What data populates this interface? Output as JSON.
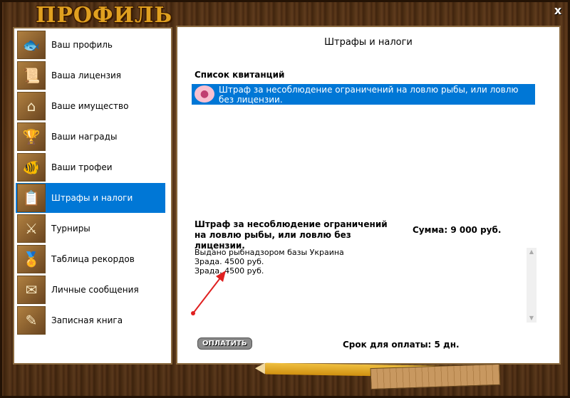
{
  "window": {
    "title": "ПРОФИЛЬ",
    "close_label": "x"
  },
  "sidebar": {
    "items": [
      {
        "label": "Ваш профиль",
        "icon": "fish-profile-icon",
        "active": false
      },
      {
        "label": "Ваша лицензия",
        "icon": "license-document-icon",
        "active": false
      },
      {
        "label": "Ваше имущество",
        "icon": "house-icon",
        "active": false
      },
      {
        "label": "Ваши награды",
        "icon": "trophy-icon",
        "active": false
      },
      {
        "label": "Ваши трофеи",
        "icon": "pike-fish-icon",
        "active": false
      },
      {
        "label": "Штрафы и налоги",
        "icon": "fine-document-icon",
        "active": true
      },
      {
        "label": "Турниры",
        "icon": "crossed-swords-icon",
        "active": false
      },
      {
        "label": "Таблица рекордов",
        "icon": "medal-icon",
        "active": false
      },
      {
        "label": "Личные сообщения",
        "icon": "envelope-icon",
        "active": false
      },
      {
        "label": "Записная книга",
        "icon": "notebook-icon",
        "active": false
      }
    ]
  },
  "main": {
    "title": "Штрафы и налоги",
    "list_title": "Список квитанций",
    "receipt": {
      "icon": "piggy-bank-icon",
      "text": "Штраф за несоблюдение ограничений на ловлю рыбы, или ловлю без лицензии."
    },
    "fine_title": "Штраф за несоблюдение ограничений на ловлю рыбы, или ловлю без лицензии.",
    "sum": "Сумма: 9 000 руб.",
    "description": [
      "Выдано рыбнадзором базы Украина",
      "Зрада. 4500 руб.",
      "Зрада. 4500 руб."
    ],
    "pay_button": "ОПЛАТИТЬ",
    "deadline": "Срок для оплаты: 5 дн."
  },
  "colors": {
    "accent": "#0077d6",
    "title": "#e0a020",
    "wood": "#5a3515",
    "arrow": "#e02020"
  }
}
